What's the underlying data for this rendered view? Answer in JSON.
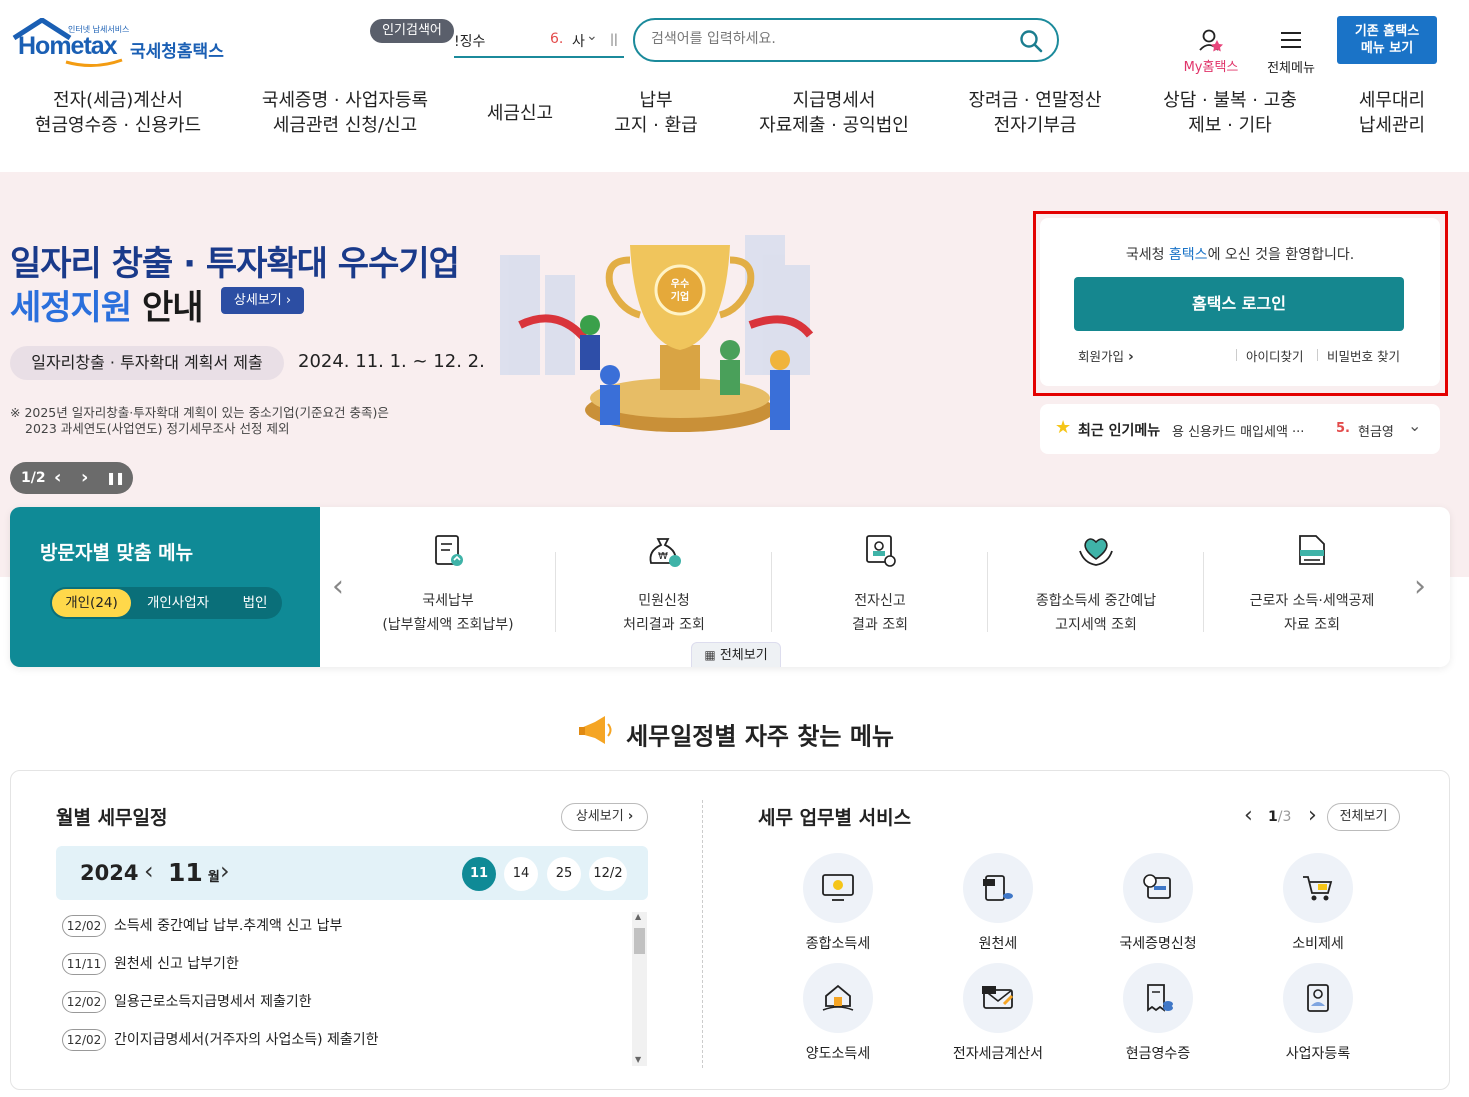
{
  "header": {
    "logo_main": "Hometax",
    "logo_small": "인터넷 납세서비스",
    "logo_sub": "국세청홈택스",
    "popular_search_label": "인기검색어",
    "popular_item_prev": "!징수",
    "popular_rank": "6.",
    "popular_item": "사",
    "search_placeholder": "검색어를 입력하세요.",
    "my_hometax": "My홈택스",
    "all_menu": "전체메뉴",
    "old_hometax_line1": "기존 홈택스",
    "old_hometax_line2": "메뉴 보기"
  },
  "nav": [
    {
      "line1": "전자(세금)계산서",
      "line2": "현금영수증 · 신용카드"
    },
    {
      "line1": "국세증명 · 사업자등록",
      "line2": "세금관련 신청/신고"
    },
    {
      "line1": "세금신고",
      "line2": ""
    },
    {
      "line1": "납부",
      "line2": "고지 · 환급"
    },
    {
      "line1": "지급명세서",
      "line2": "자료제출 · 공익법인"
    },
    {
      "line1": "장려금 · 연말정산",
      "line2": "전자기부금"
    },
    {
      "line1": "상담 · 불복 · 고충",
      "line2": "제보 · 기타"
    },
    {
      "line1": "세무대리",
      "line2": "납세관리"
    }
  ],
  "banner": {
    "title_line1": "일자리 창출 · 투자확대 우수기업",
    "title_line2_a": "세정지원",
    "title_line2_b": "안내",
    "detail_button": "상세보기",
    "chip_label": "일자리창출 · 투자확대 계획서 제출",
    "period": "2024. 11. 1. ~ 12. 2.",
    "note_line1": "※ 2025년 일자리창출·투자확대 계획이 있는 중소기업(기준요건 충족)은",
    "note_line2": "2023 과세연도(사업연도) 정기세무조사 선정 제외",
    "pager": "1/2",
    "trophy_badge_line1": "우수",
    "trophy_badge_line2": "기업"
  },
  "login": {
    "welcome_a": "국세청 ",
    "welcome_b": "홈택스",
    "welcome_c": "에 오신 것을 환영합니다.",
    "login_button": "홈택스 로그인",
    "signup": "회원가입",
    "find_id": "아이디찾기",
    "find_pw": "비밀번호 찾기"
  },
  "popular_menu": {
    "label": "최근 인기메뉴",
    "item": "용 신용카드 매입세액 ···",
    "rank": "5.",
    "next_item": "현금영"
  },
  "visitor_menu": {
    "title": "방문자별 맞춤 메뉴",
    "tabs": [
      "개인(24)",
      "개인사업자",
      "법인"
    ],
    "items": [
      {
        "line1": "국세납부",
        "line2": "(납부할세액 조회납부)"
      },
      {
        "line1": "민원신청",
        "line2": "처리결과 조회"
      },
      {
        "line1": "전자신고",
        "line2": "결과 조회"
      },
      {
        "line1": "종합소득세 중간예납",
        "line2": "고지세액 조회"
      },
      {
        "line1": "근로자 소득·세액공제",
        "line2": "자료 조회"
      }
    ],
    "view_all": "전체보기"
  },
  "section_title": "세무일정별 자주 찾는 메뉴",
  "schedule": {
    "title": "월별 세무일정",
    "detail_button": "상세보기",
    "year": "2024",
    "month": "11",
    "month_unit": "월",
    "days": [
      "11",
      "14",
      "25",
      "12/2"
    ],
    "rows": [
      {
        "date": "12/02",
        "text": "소득세 중간예납 납부.추계액 신고 납부"
      },
      {
        "date": "11/11",
        "text": "원천세 신고 납부기한"
      },
      {
        "date": "12/02",
        "text": "일용근로소득지급명세서 제출기한"
      },
      {
        "date": "12/02",
        "text": "간이지급명세서(거주자의 사업소득) 제출기한"
      }
    ]
  },
  "services": {
    "title": "세무 업무별 서비스",
    "page_current": "1",
    "page_total": "3",
    "view_all": "전체보기",
    "items": [
      "종합소득세",
      "원천세",
      "국세증명신청",
      "소비제세",
      "양도소득세",
      "전자세금계산서",
      "현금영수증",
      "사업자등록"
    ]
  },
  "colors": {
    "teal": "#0f8a96",
    "blue": "#1a73c7",
    "navy": "#1a3a8a",
    "red_frame": "#e30000",
    "banner_bg": "#f9eeef"
  }
}
